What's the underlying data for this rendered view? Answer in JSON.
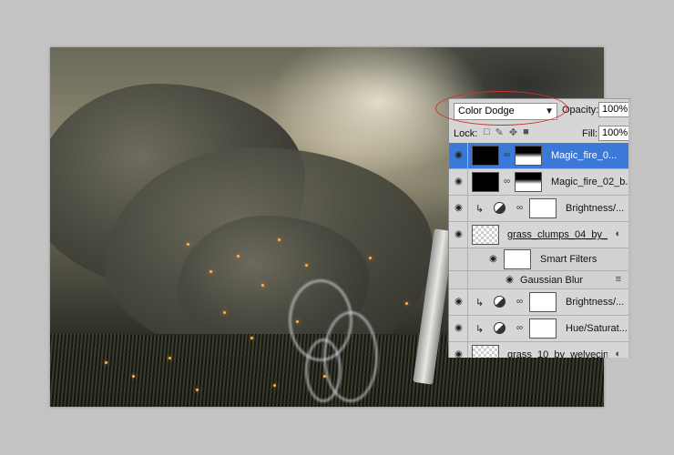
{
  "blend_panel": {
    "blend_mode": "Color Dodge",
    "opacity_label": "Opacity:",
    "opacity_value": "100%",
    "lock_label": "Lock:",
    "fill_label": "Fill:",
    "fill_value": "100%"
  },
  "layers": [
    {
      "name": "Magic_fire_0...",
      "selected": true
    },
    {
      "name": "Magic_fire_02_b..."
    },
    {
      "name": "Brightness/..."
    },
    {
      "name": "grass_clumps_04_by_..."
    },
    {
      "name": "Smart Filters"
    },
    {
      "name": "Gaussian Blur"
    },
    {
      "name": "Brightness/..."
    },
    {
      "name": "Hue/Saturat..."
    },
    {
      "name": "grass_10_by_welvecin..."
    }
  ],
  "colors": {
    "selection": "#3b78d7",
    "highlight_oval": "#c8342c"
  }
}
